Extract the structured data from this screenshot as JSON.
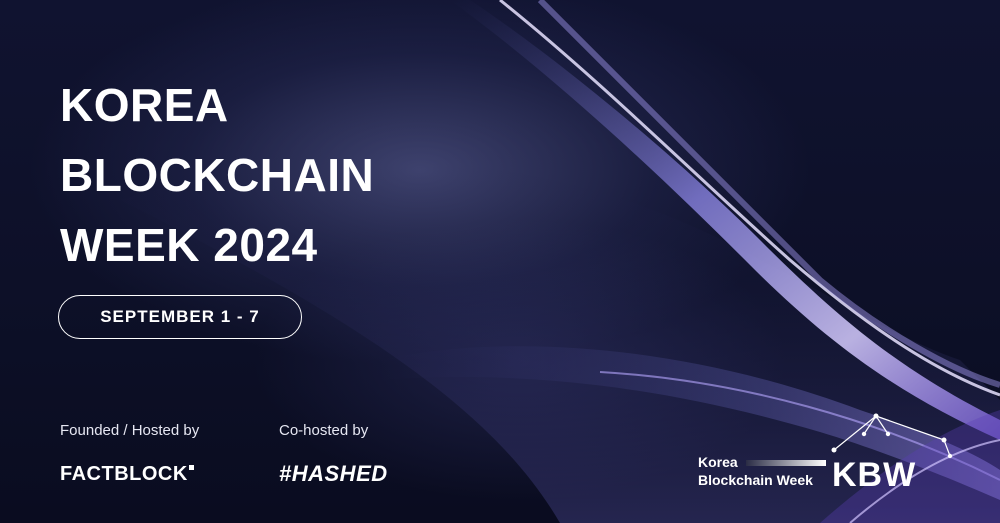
{
  "event": {
    "title_lines": [
      "KOREA",
      "BLOCKCHAIN",
      "WEEK 2024"
    ],
    "dates": "SEPTEMBER 1 - 7"
  },
  "credits": {
    "founded_label": "Founded / Hosted by",
    "founded_org": "FACTBLOCK",
    "cohosted_label": "Co-hosted by",
    "cohosted_org": "#HASHED"
  },
  "logo": {
    "line1": "Korea",
    "line2": "Blockchain Week",
    "mark": "KBW"
  },
  "colors": {
    "background": "#0b0d22",
    "accent_light": "#c8b8ff",
    "accent_mid": "#7a6fd8",
    "text": "#ffffff"
  },
  "icons": [
    "constellation-icon"
  ]
}
